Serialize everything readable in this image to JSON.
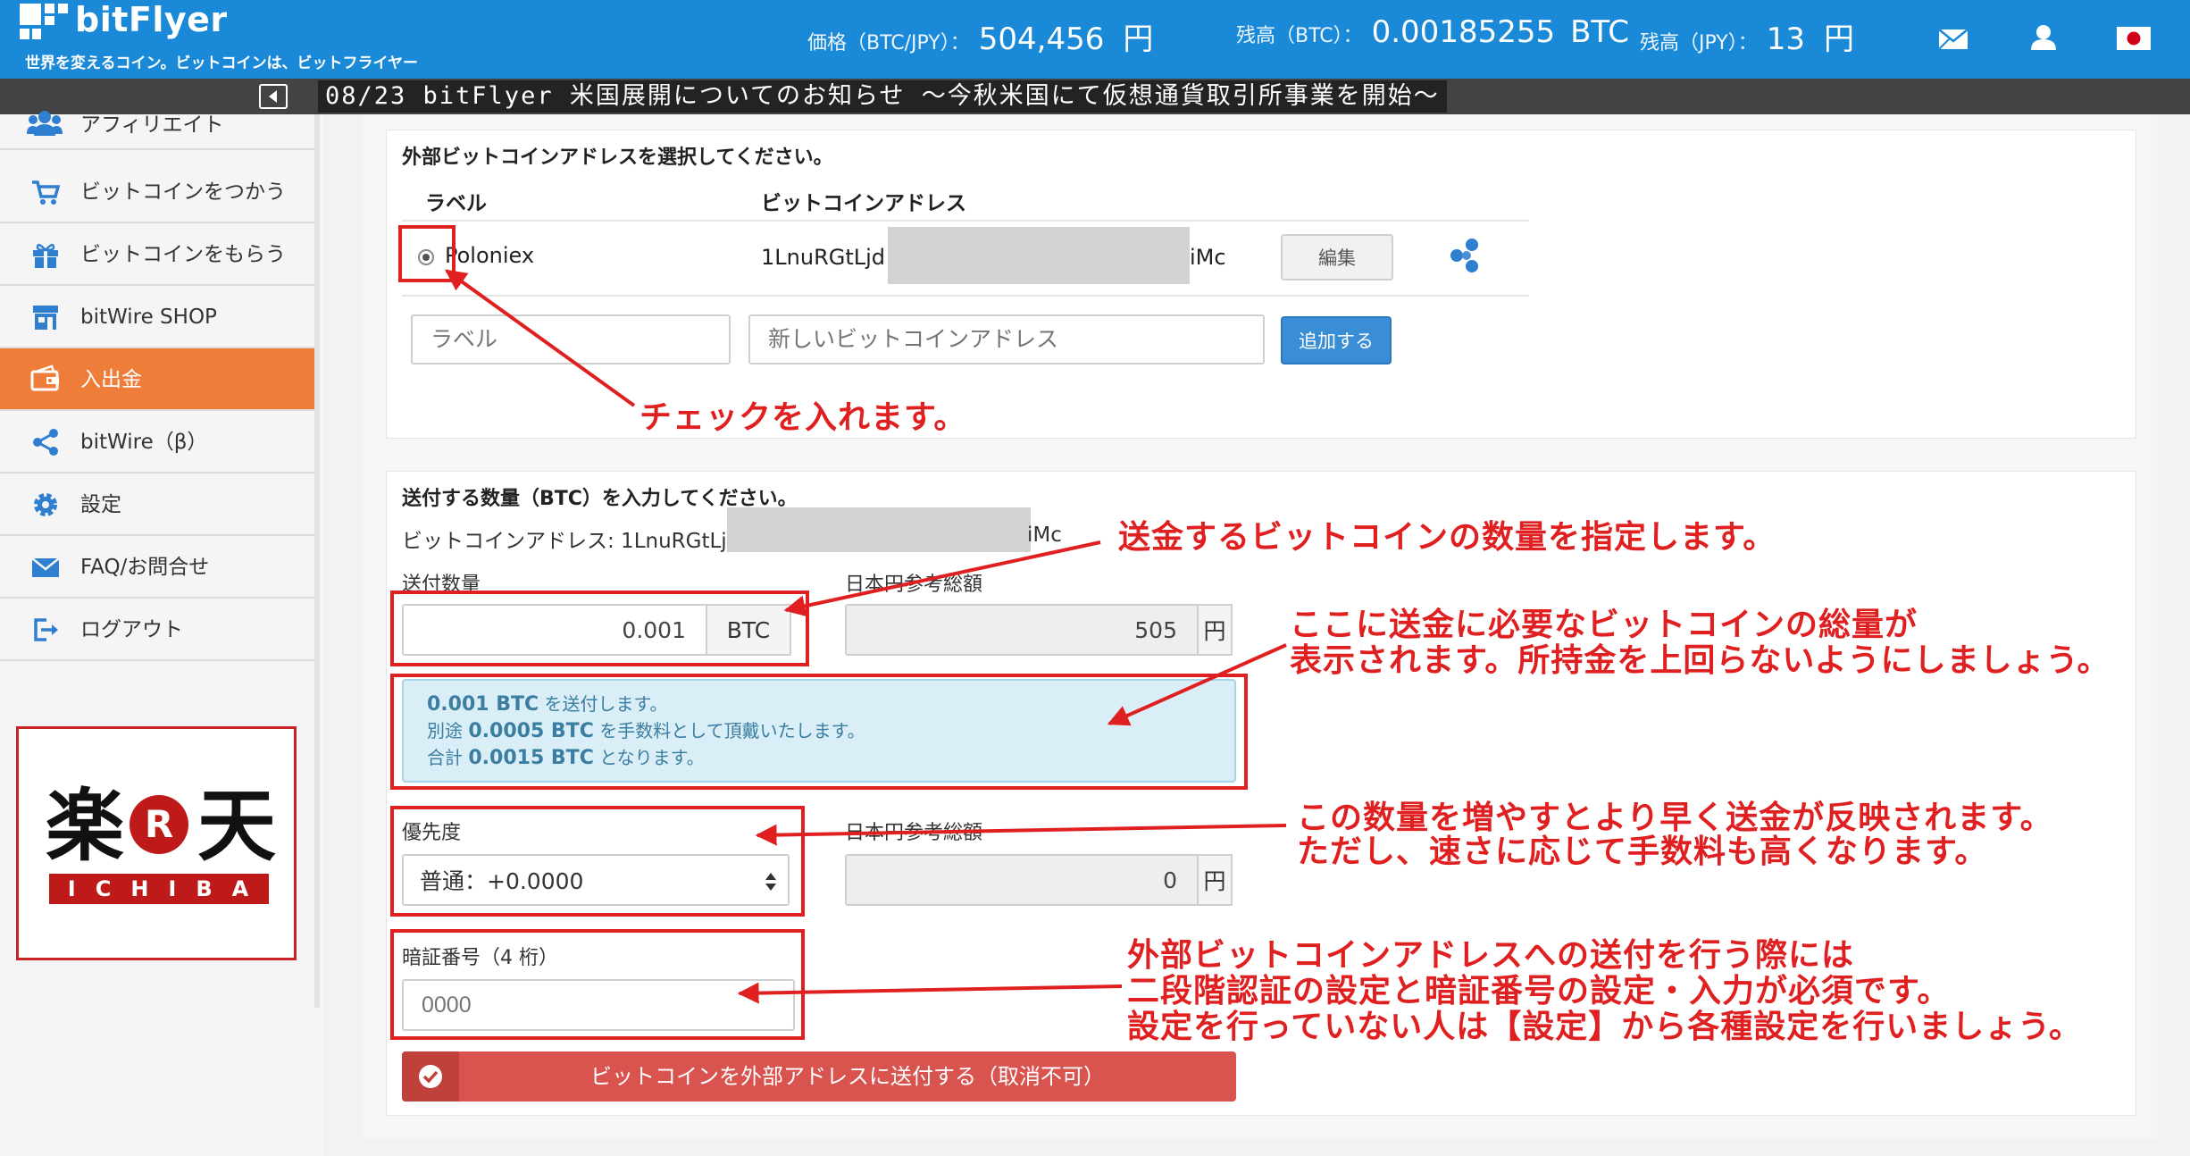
{
  "header": {
    "logo_text": "bitFlyer",
    "tagline": "世界を変えるコイン。ビットコインは、ビットフライヤー",
    "price_label": "価格（BTC/JPY）：",
    "price_value": "504,456",
    "price_unit": "円",
    "btc_balance_label": "残高（BTC）：",
    "btc_balance_value": "0.00185255",
    "btc_balance_unit": "BTC",
    "jpy_balance_label": "残高（JPY）：",
    "jpy_balance_value": "13",
    "jpy_balance_unit": "円",
    "icons": [
      "mail-icon",
      "user-icon",
      "japan-flag-icon"
    ]
  },
  "news": {
    "text": "08/23 bitFlyer 米国展開についてのお知らせ ～今秋米国にて仮想通貨取引所事業を開始～"
  },
  "sidebar": {
    "items": [
      {
        "label": "アフィリエイト",
        "icon": "users-icon"
      },
      {
        "label": "ビットコインをつかう",
        "icon": "cart-icon"
      },
      {
        "label": "ビットコインをもらう",
        "icon": "gift-icon"
      },
      {
        "label": "bitWire SHOP",
        "icon": "shop-icon"
      },
      {
        "label": "入出金",
        "icon": "wallet-icon",
        "active": true
      },
      {
        "label": "bitWire（β）",
        "icon": "share-icon"
      },
      {
        "label": "設定",
        "icon": "gear-icon"
      },
      {
        "label": "FAQ/お問合せ",
        "icon": "envelope-icon"
      },
      {
        "label": "ログアウト",
        "icon": "logout-icon"
      }
    ],
    "ad": {
      "line1": "楽",
      "circle": "R",
      "line2": "天",
      "sub": "ICHIBA"
    }
  },
  "address_section": {
    "title": "外部ビットコインアドレスを選択してください。",
    "columns": [
      "ラベル",
      "ビットコインアドレス"
    ],
    "rows": [
      {
        "label": "Poloniex",
        "address_start": "1LnuRGtLjd",
        "address_end": "iMc",
        "edit_label": "編集",
        "selected": true
      }
    ],
    "new_label_placeholder": "ラベル",
    "new_address_placeholder": "新しいビットコインアドレス",
    "add_button": "追加する"
  },
  "send_section": {
    "title": "送付する数量（BTC）を入力してください。",
    "address_prefix": "ビットコインアドレス: 1LnuRGtLjd",
    "address_end": "iMc",
    "amount_label": "送付数量",
    "amount_value": "0.001",
    "amount_unit": "BTC",
    "jpy_ref_label": "日本円参考総額",
    "jpy_ref_value": "505",
    "jpy_unit": "円",
    "info": {
      "line1_value": "0.001 BTC",
      "line1_text": "を送付します。",
      "line2_prefix": "別途",
      "line2_value": "0.0005 BTC",
      "line2_text": "を手数料として頂戴いたします。",
      "line3_prefix": "合計",
      "line3_value": "0.0015 BTC",
      "line3_text": "となります。"
    },
    "priority_label": "優先度",
    "priority_value": "普通：+0.0000",
    "priority_jpy_label": "日本円参考総額",
    "priority_jpy_value": "0",
    "pin_label": "暗証番号（4 桁）",
    "pin_placeholder": "0000",
    "send_button": "ビットコインを外部アドレスに送付する（取消不可）"
  },
  "annotations": {
    "check": "チェックを入れます。",
    "amount": "送金するビットコインの数量を指定します。",
    "total_1": "ここに送金に必要なビットコインの総量が",
    "total_2": "表示されます。所持金を上回らないようにしましょう。",
    "priority_1": "この数量を増やすとより早く送金が反映されます。",
    "priority_2": "ただし、速さに応じて手数料も高くなります。",
    "pin_1": "外部ビットコインアドレスへの送付を行う際には",
    "pin_2": "二段階認証の設定と暗証番号の設定・入力が必須です。",
    "pin_3": "設定を行っていない人は【設定】から各種設定を行いましょう。"
  },
  "colors": {
    "header_blue": "#1a8ad8",
    "active_orange": "#ee7d3a",
    "annotation_red": "#e02020",
    "send_button_red": "#d9534f",
    "add_button_blue": "#3a8ed6",
    "info_bg": "#d9eef6"
  }
}
